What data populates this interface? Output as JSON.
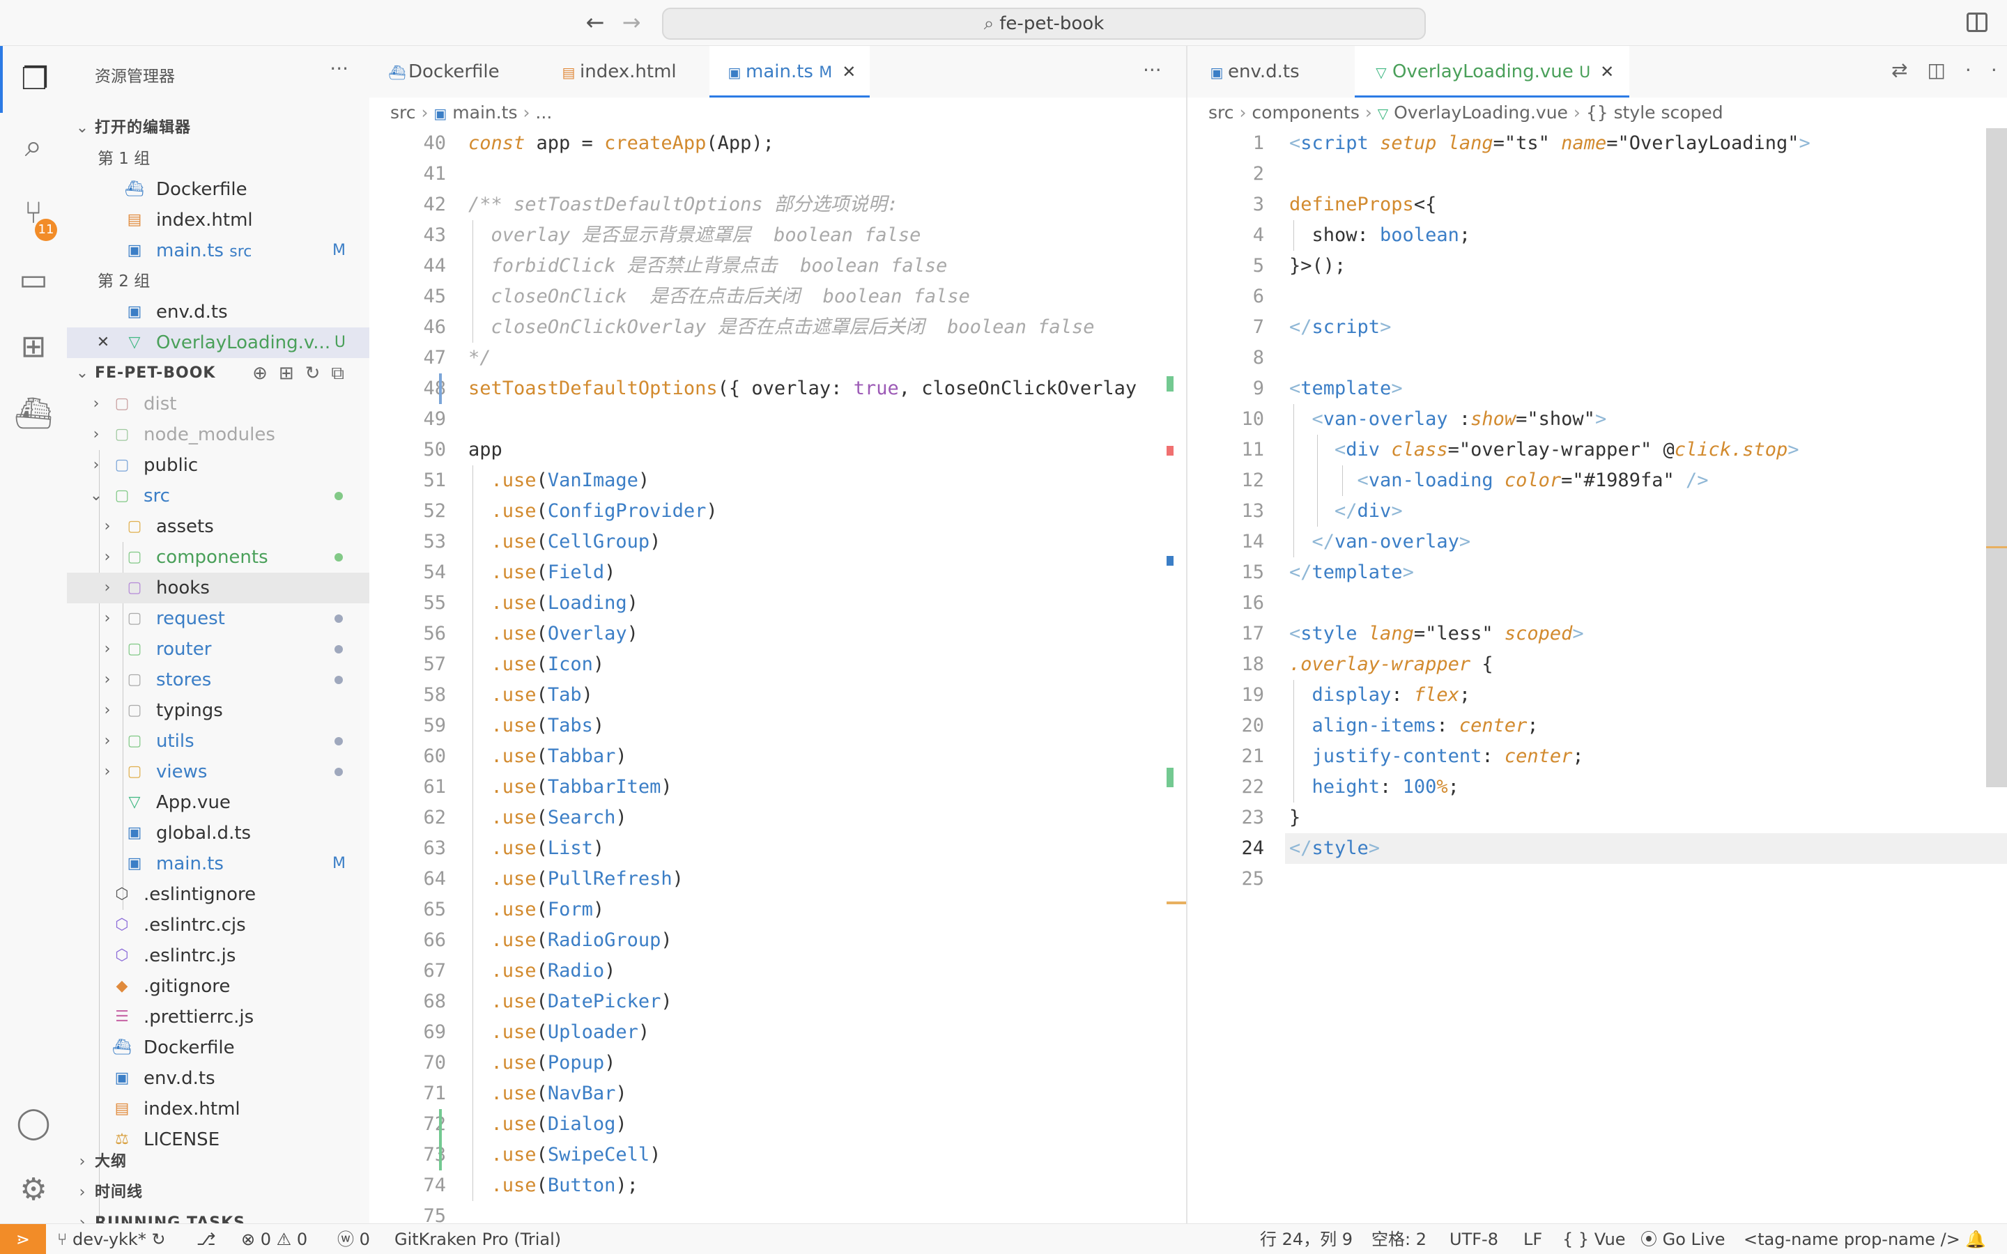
{
  "titlebar": {
    "search": "fe-pet-book",
    "back": "←",
    "forward": "→"
  },
  "activity": {
    "scm_badge": "11"
  },
  "explorer": {
    "title": "资源管理器",
    "open_editors": "打开的编辑器",
    "group1": "第 1 组",
    "group2": "第 2 组",
    "open1": [
      {
        "name": "Dockerfile",
        "hint": "",
        "deco": ""
      },
      {
        "name": "index.html",
        "hint": "",
        "deco": ""
      },
      {
        "name": "main.ts",
        "hint": "src",
        "deco": "M"
      }
    ],
    "open2": [
      {
        "name": "env.d.ts",
        "deco": ""
      },
      {
        "name": "OverlayLoading.v...",
        "deco": "U"
      }
    ],
    "project": "FE-PET-BOOK",
    "tree": [
      {
        "name": "dist"
      },
      {
        "name": "node_modules"
      },
      {
        "name": "public"
      },
      {
        "name": "src"
      },
      {
        "name": "assets"
      },
      {
        "name": "components"
      },
      {
        "name": "hooks"
      },
      {
        "name": "request"
      },
      {
        "name": "router"
      },
      {
        "name": "stores"
      },
      {
        "name": "typings"
      },
      {
        "name": "utils"
      },
      {
        "name": "views"
      },
      {
        "name": "App.vue"
      },
      {
        "name": "global.d.ts"
      },
      {
        "name": "main.ts",
        "deco": "M"
      },
      {
        "name": ".eslintignore"
      },
      {
        "name": ".eslintrc.cjs"
      },
      {
        "name": ".eslintrc.js"
      },
      {
        "name": ".gitignore"
      },
      {
        "name": ".prettierrc.js"
      },
      {
        "name": "Dockerfile"
      },
      {
        "name": "env.d.ts"
      },
      {
        "name": "index.html"
      },
      {
        "name": "LICENSE"
      }
    ],
    "outline": "大纲",
    "timeline": "时间线",
    "running_tasks": "RUNNING TASKS"
  },
  "editor_left": {
    "tabs": [
      {
        "label": "Dockerfile"
      },
      {
        "label": "index.html"
      },
      {
        "label": "main.ts",
        "deco": "M"
      }
    ],
    "crumbs": [
      "src",
      "main.ts",
      "..."
    ],
    "lines": [
      "40",
      "41",
      "42",
      "43",
      "44",
      "45",
      "46",
      "47",
      "48",
      "49",
      "50",
      "51",
      "52",
      "53",
      "54",
      "55",
      "56",
      "57",
      "58",
      "59",
      "60",
      "61",
      "62",
      "63",
      "64",
      "65",
      "66",
      "67",
      "68",
      "69",
      "70",
      "71",
      "72",
      "73",
      "74",
      "75"
    ],
    "code": {
      "l40": [
        "const",
        " app = ",
        "createApp",
        "(App);"
      ],
      "l42": "/** setToastDefaultOptions 部分选项说明:",
      "l43": "  overlay 是否显示背景遮罩层  boolean false",
      "l44": "  forbidClick 是否禁止背景点击  boolean false",
      "l45": "  closeOnClick  是否在点击后关闭  boolean false",
      "l46": "  closeOnClickOverlay 是否在点击遮罩层后关闭  boolean false",
      "l47": "*/",
      "l48": [
        "setToastDefaultOptions",
        "({ overlay: ",
        "true",
        ", closeOnClickOverlay"
      ],
      "l50": "app",
      "uses": [
        "VanImage",
        "ConfigProvider",
        "CellGroup",
        "Field",
        "Loading",
        "Overlay",
        "Icon",
        "Tab",
        "Tabs",
        "Tabbar",
        "TabbarItem",
        "Search",
        "List",
        "PullRefresh",
        "Form",
        "RadioGroup",
        "Radio",
        "DatePicker",
        "Uploader",
        "Popup",
        "NavBar",
        "Dialog",
        "SwipeCell",
        "Button"
      ],
      "use_kw": ".use",
      "last_suffix": ");"
    }
  },
  "editor_right": {
    "tabs": [
      {
        "label": "env.d.ts"
      },
      {
        "label": "OverlayLoading.vue",
        "deco": "U"
      }
    ],
    "crumbs": [
      "src",
      "components",
      "OverlayLoading.vue",
      "{} style scoped"
    ],
    "lines": [
      "1",
      "2",
      "3",
      "4",
      "5",
      "6",
      "7",
      "8",
      "9",
      "10",
      "11",
      "12",
      "13",
      "14",
      "15",
      "16",
      "17",
      "18",
      "19",
      "20",
      "21",
      "22",
      "23",
      "24",
      "25"
    ],
    "code": {
      "l1": [
        "<",
        "script",
        " setup",
        " lang",
        "=\"ts\"",
        " name",
        "=\"OverlayLoading\"",
        ">"
      ],
      "l3": [
        "defineProps",
        "<{"
      ],
      "l4": [
        "  show: ",
        "boolean",
        ";"
      ],
      "l5": "}>();",
      "l7": [
        "</",
        "script",
        ">"
      ],
      "l9": [
        "<",
        "template",
        ">"
      ],
      "l10": [
        "  <",
        "van-overlay",
        " :",
        "show",
        "=\"show\"",
        ">"
      ],
      "l11": [
        "    <",
        "div",
        " class",
        "=\"overlay-wrapper\"",
        " @",
        "click",
        ".stop",
        ">"
      ],
      "l12": [
        "      <",
        "van-loading",
        " color",
        "=\"#1989fa\"",
        " />"
      ],
      "l13": [
        "    </",
        "div",
        ">"
      ],
      "l14": [
        "  </",
        "van-overlay",
        ">"
      ],
      "l15": [
        "</",
        "template",
        ">"
      ],
      "l17": [
        "<",
        "style",
        " lang",
        "=\"less\"",
        " scoped",
        ">"
      ],
      "l18": [
        ".overlay-wrapper",
        " {"
      ],
      "l19": [
        "  display",
        ": ",
        "flex",
        ";"
      ],
      "l20": [
        "  align-items",
        ": ",
        "center",
        ";"
      ],
      "l21": [
        "  justify-content",
        ": ",
        "center",
        ";"
      ],
      "l22": [
        "  height",
        ": ",
        "100",
        "%",
        ";"
      ],
      "l23": "}",
      "l24": [
        "</",
        "style",
        ">"
      ]
    }
  },
  "status": {
    "branch": "dev-ykk*",
    "errors": "0",
    "warnings": "0",
    "ports": "0",
    "gitkraken": "GitKraken Pro (Trial)",
    "position": "行 24，列 9",
    "spaces": "空格: 2",
    "encoding": "UTF-8",
    "eol": "LF",
    "language": "Vue",
    "golive": "Go Live",
    "tag": "<tag-name prop-name />"
  },
  "colors": {
    "accent": "#2c7be5",
    "badge": "#f28c28",
    "modified": "#3b7ec6",
    "untracked": "#4aa05a"
  }
}
